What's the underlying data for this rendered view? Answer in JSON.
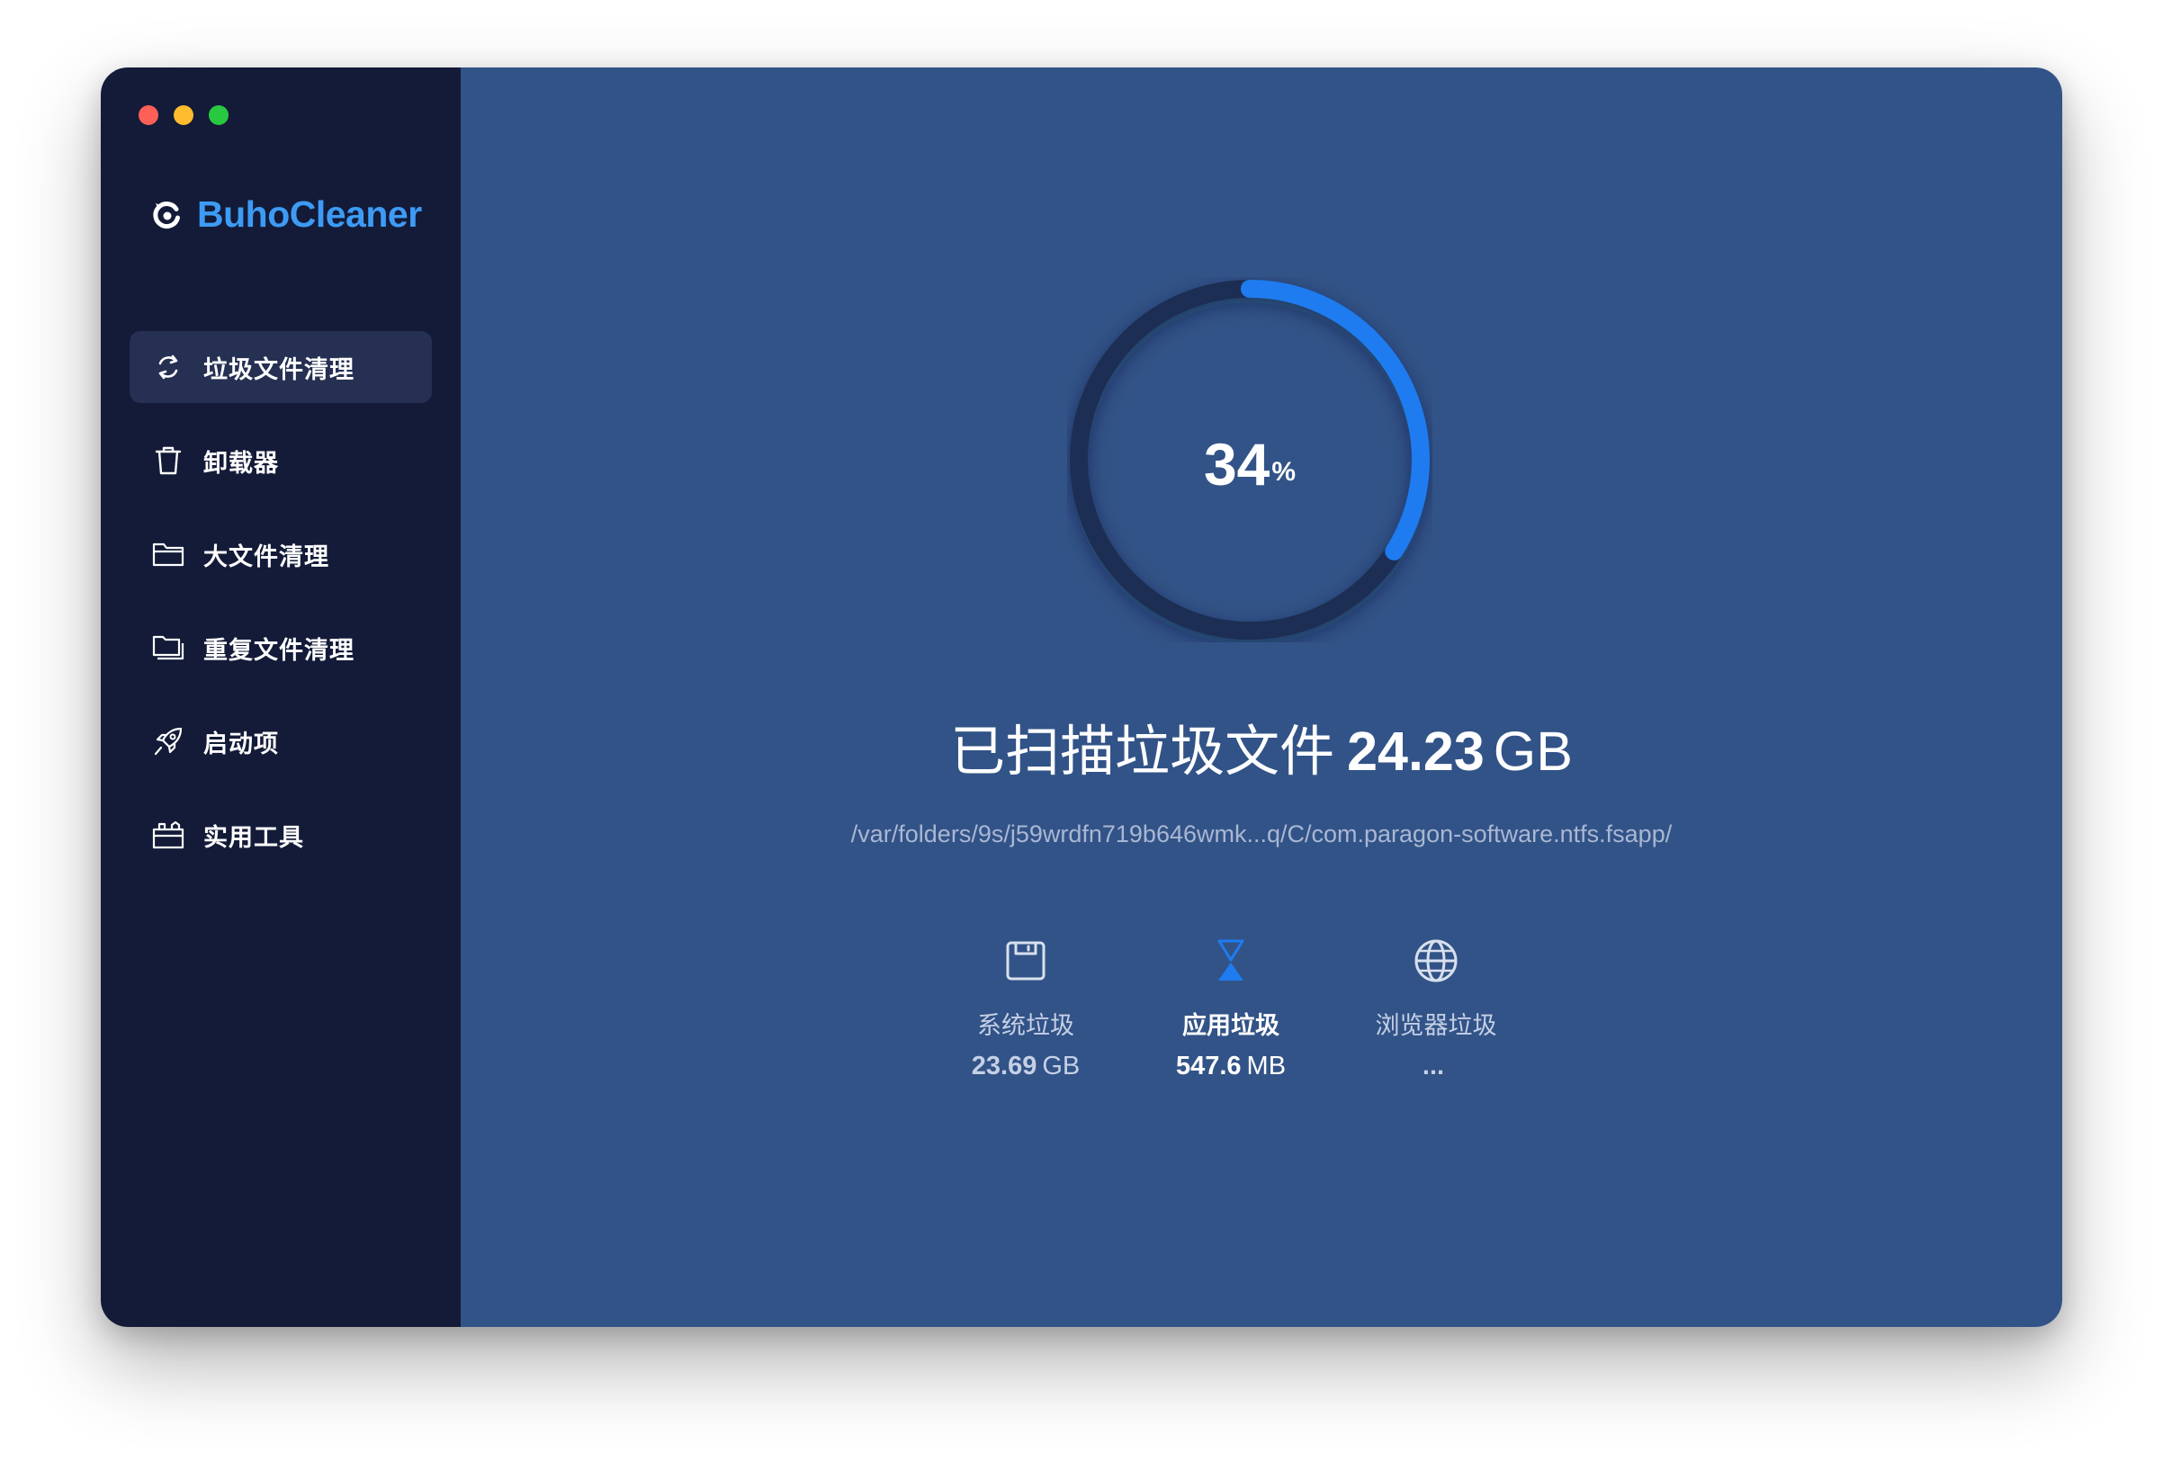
{
  "window": {
    "traffic_lights": {
      "close_color": "#fe5f57",
      "minimize_color": "#febc2e",
      "zoom_color": "#28c840"
    }
  },
  "sidebar": {
    "brand": {
      "name": "BuhoCleaner",
      "icon": "buho-logo-icon",
      "color": "#3d9bf5"
    },
    "items": [
      {
        "label": "垃圾文件清理",
        "icon": "refresh-cycle-icon",
        "active": true
      },
      {
        "label": "卸载器",
        "icon": "trash-can-icon",
        "active": false
      },
      {
        "label": "大文件清理",
        "icon": "folder-icon",
        "active": false
      },
      {
        "label": "重复文件清理",
        "icon": "folder-stack-icon",
        "active": false
      },
      {
        "label": "启动项",
        "icon": "rocket-icon",
        "active": false
      },
      {
        "label": "实用工具",
        "icon": "toolbox-icon",
        "active": false
      }
    ]
  },
  "scan": {
    "progress": {
      "value": 34,
      "symbol": "%",
      "track_color": "#1e2f52",
      "fill_color": "#1e7cf0"
    },
    "headline": {
      "label": "已扫描垃圾文件",
      "size": "24.23",
      "unit": "GB"
    },
    "current_path": "/var/folders/9s/j59wrdfn719b646wmk...q/C/com.paragon-software.ntfs.fsapp/"
  },
  "categories": [
    {
      "label": "系统垃圾",
      "value": "23.69",
      "unit": "GB",
      "icon": "disk-icon",
      "active": false
    },
    {
      "label": "应用垃圾",
      "value": "547.6",
      "unit": "MB",
      "icon": "hourglass-icon",
      "active": true
    },
    {
      "label": "浏览器垃圾",
      "value": "...",
      "unit": "",
      "icon": "globe-icon",
      "active": false
    }
  ]
}
